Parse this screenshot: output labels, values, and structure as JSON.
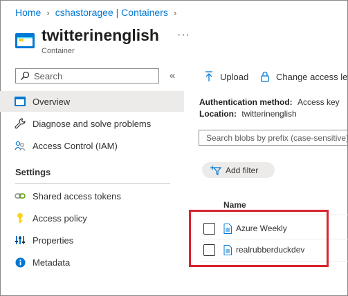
{
  "breadcrumb": {
    "home": "Home",
    "account": "cshastoragee | Containers"
  },
  "header": {
    "title": "twitterinenglish",
    "more": "···",
    "subtitle": "Container"
  },
  "sidebar": {
    "search_placeholder": "Search",
    "collapse": "«",
    "items": [
      {
        "label": "Overview",
        "icon": "container-icon"
      },
      {
        "label": "Diagnose and solve problems",
        "icon": "wrench-icon"
      },
      {
        "label": "Access Control (IAM)",
        "icon": "people-icon"
      }
    ],
    "settings_heading": "Settings",
    "settings_items": [
      {
        "label": "Shared access tokens",
        "icon": "link-icon"
      },
      {
        "label": "Access policy",
        "icon": "key-icon"
      },
      {
        "label": "Properties",
        "icon": "properties-icon"
      },
      {
        "label": "Metadata",
        "icon": "info-icon"
      }
    ]
  },
  "toolbar": {
    "upload": "Upload",
    "change_access": "Change access lev"
  },
  "info": {
    "auth_label": "Authentication method:",
    "auth_value": "Access key",
    "location_label": "Location:",
    "location_value": "twitterinenglish"
  },
  "blob_search_placeholder": "Search blobs by prefix (case-sensitive)",
  "add_filter": "Add filter",
  "table": {
    "column_name": "Name",
    "rows": [
      {
        "name": "Azure Weekly"
      },
      {
        "name": "realrubberduckdev"
      }
    ]
  },
  "colors": {
    "link": "#0078d4",
    "highlight": "#d9242c",
    "active_bg": "#edebe9"
  }
}
